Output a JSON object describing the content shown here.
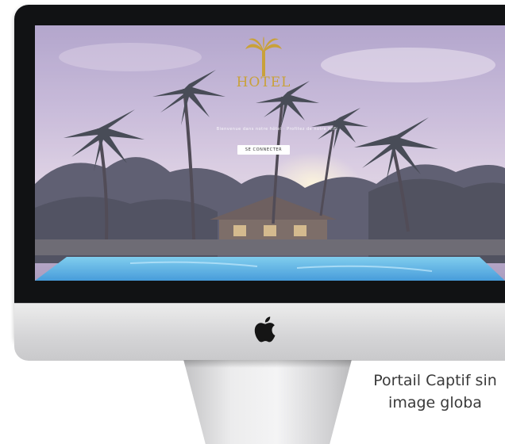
{
  "device": {
    "type": "iMac",
    "bezel_color": "#111214",
    "chin_color": "#dcdcde",
    "logo_icon": "apple-icon"
  },
  "portal": {
    "brand_text": "HOTEL",
    "brand_color": "#c9a13a",
    "logo_icon": "palm-tree-icon",
    "welcome_text": "Bienvenue dans notre hôtel · Profitez de notre WiFi",
    "connect_button_label": "SE CONNECTER",
    "background_scene": "tropical-resort-pool-palms"
  },
  "caption": {
    "line1": "Portail Captif sin",
    "line2": "image globa"
  }
}
